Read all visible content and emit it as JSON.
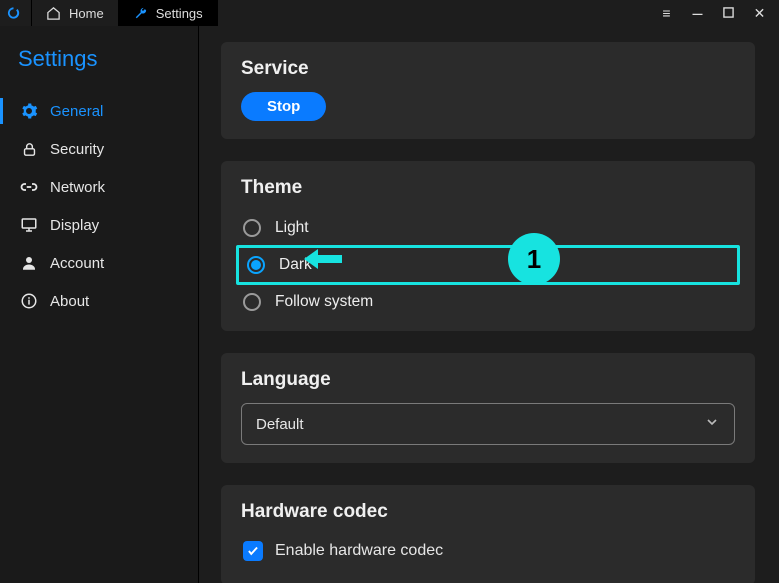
{
  "colors": {
    "accent": "#1a93ff",
    "highlight": "#17e3e0"
  },
  "tabs": {
    "home": "Home",
    "settings": "Settings"
  },
  "sidebar": {
    "title": "Settings",
    "items": [
      {
        "label": "General"
      },
      {
        "label": "Security"
      },
      {
        "label": "Network"
      },
      {
        "label": "Display"
      },
      {
        "label": "Account"
      },
      {
        "label": "About"
      }
    ]
  },
  "service": {
    "title": "Service",
    "button": "Stop"
  },
  "theme": {
    "title": "Theme",
    "options": [
      {
        "label": "Light"
      },
      {
        "label": "Dark",
        "selected": true
      },
      {
        "label": "Follow system"
      }
    ]
  },
  "language": {
    "title": "Language",
    "value": "Default"
  },
  "hardware": {
    "title": "Hardware codec",
    "checkbox_label": "Enable hardware codec",
    "checked": true
  },
  "annotation": {
    "badge": "1"
  }
}
